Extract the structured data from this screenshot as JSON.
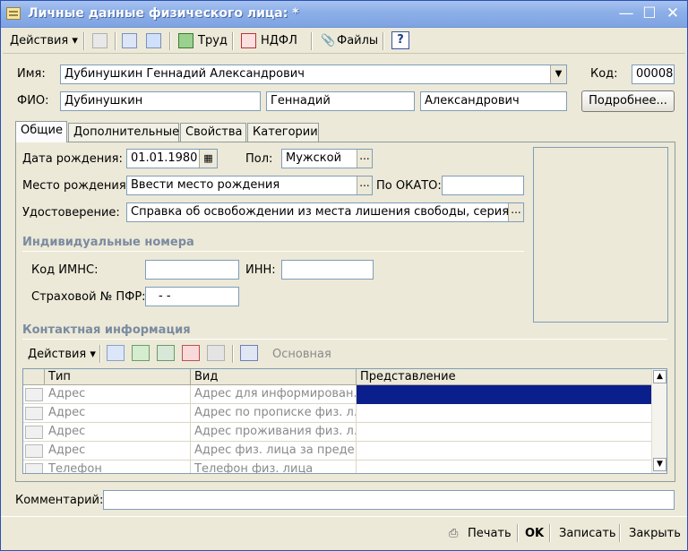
{
  "window": {
    "title": "Личные данные физического лица: *"
  },
  "toolbar": {
    "actions": "Действия",
    "trud": "Труд",
    "ndfl": "НДФЛ",
    "files": "Файлы",
    "help": "?"
  },
  "form": {
    "name_label": "Имя:",
    "name_value": "Дубинушкин Геннадий Александрович",
    "code_label": "Код:",
    "code_value": "00008",
    "fio_label": "ФИО:",
    "last_name": "Дубинушкин",
    "first_name": "Геннадий",
    "middle_name": "Александрович",
    "more_button": "Подробнее..."
  },
  "tabs": [
    "Общие",
    "Дополнительные",
    "Свойства",
    "Категории"
  ],
  "general": {
    "birth_date_label": "Дата рождения:",
    "birth_date": "01.01.1980",
    "gender_label": "Пол:",
    "gender": "Мужской",
    "birth_place_label": "Место рождения:",
    "birth_place": "Ввести место рождения",
    "okato_label": "По ОКАТО:",
    "okato": "",
    "id_doc_label": "Удостоверение:",
    "id_doc": "Справка об освобождении из  места лишения свободы, серия: , N"
  },
  "individual_numbers": {
    "title": "Индивидуальные номера",
    "imns_label": "Код ИМНС:",
    "imns": "",
    "inn_label": "ИНН:",
    "inn": "",
    "pfr_label": "Страховой № ПФР:",
    "pfr": "-  -"
  },
  "contacts": {
    "title": "Контактная информация",
    "actions": "Действия",
    "main_label": "Основная",
    "columns": [
      "Тип",
      "Вид",
      "Представление"
    ],
    "rows": [
      {
        "type": "Адрес",
        "kind": "Адрес для информирован...",
        "view": ""
      },
      {
        "type": "Адрес",
        "kind": "Адрес по прописке физ. л...",
        "view": ""
      },
      {
        "type": "Адрес",
        "kind": "Адрес проживания физ. л...",
        "view": ""
      },
      {
        "type": "Адрес",
        "kind": "Адрес физ. лица за преде...",
        "view": ""
      },
      {
        "type": "Телефон",
        "kind": "Телефон физ. лица",
        "view": ""
      }
    ]
  },
  "comment": {
    "label": "Комментарий:",
    "value": ""
  },
  "footer": {
    "print": "Печать",
    "ok": "OK",
    "save": "Записать",
    "close": "Закрыть"
  },
  "colors": {
    "selection": "#0a1f8c",
    "title_bar": "#8db0e8"
  }
}
